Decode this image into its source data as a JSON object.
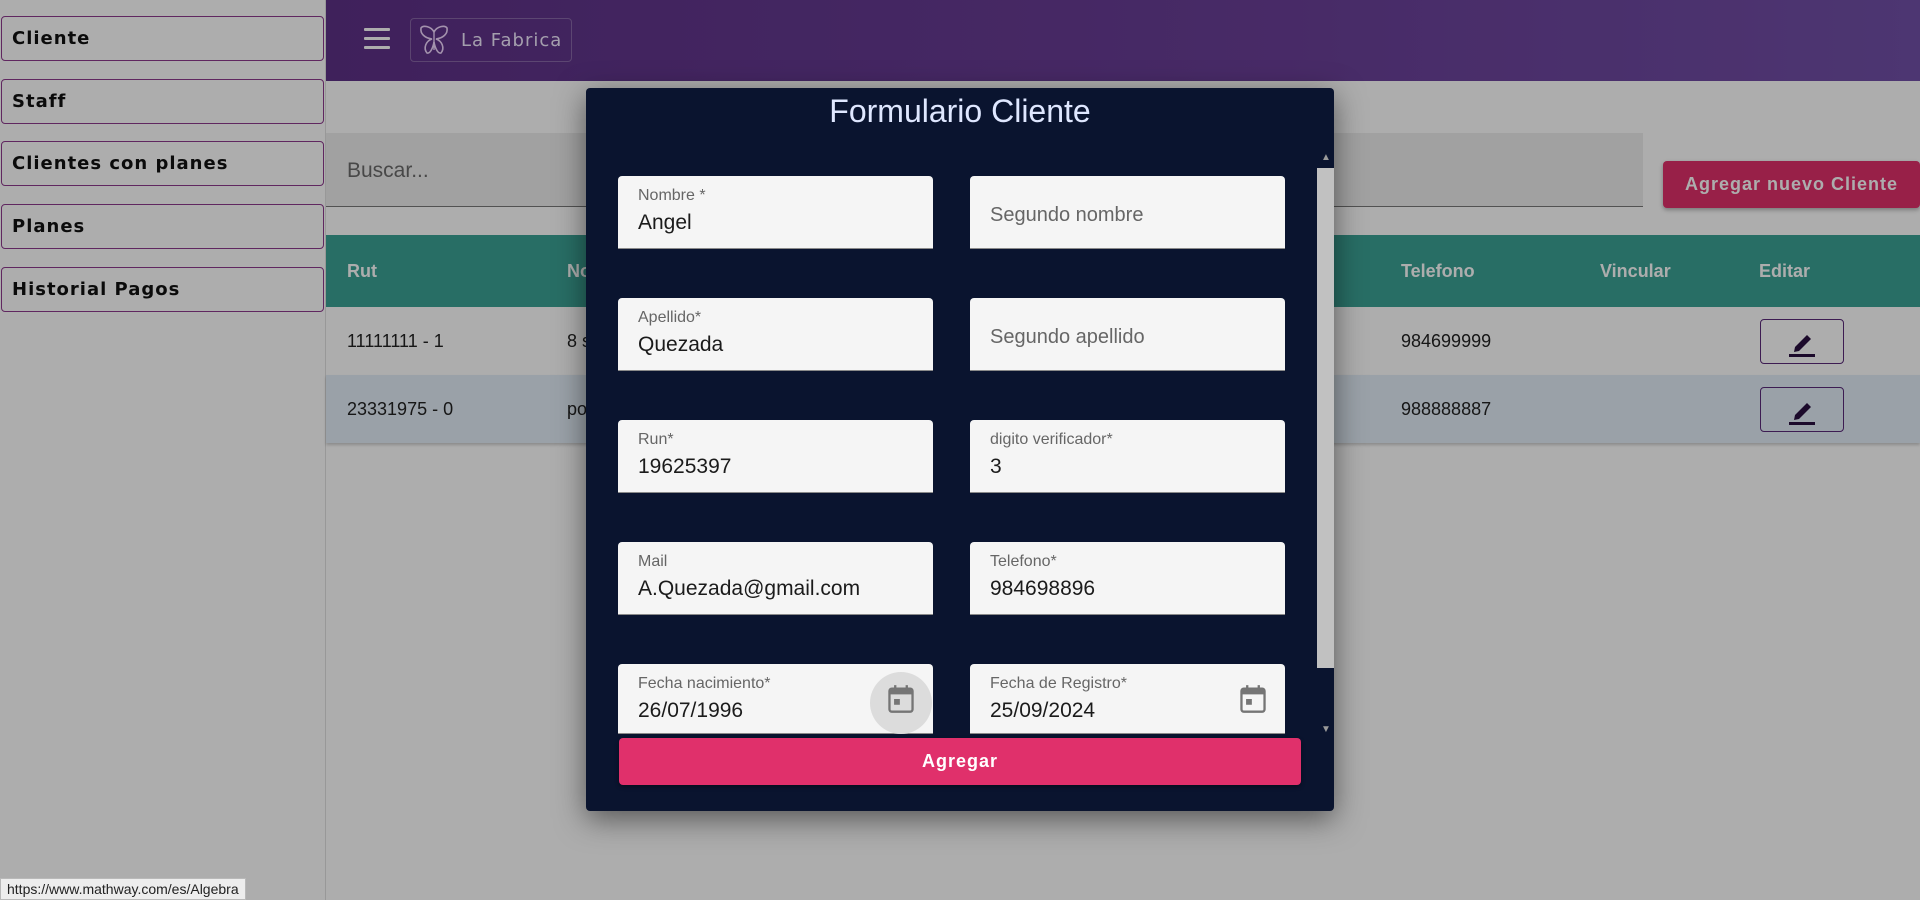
{
  "sidebar": {
    "items": [
      {
        "label": "Cliente"
      },
      {
        "label": "Staff"
      },
      {
        "label": "Clientes con planes"
      },
      {
        "label": "Planes"
      },
      {
        "label": "Historial Pagos"
      }
    ]
  },
  "appbar": {
    "brand": "La Fabrica",
    "menu_icon": "menu-icon",
    "logo_icon": "butterfly-icon",
    "gradient": [
      "#5e3187",
      "#7250a8"
    ]
  },
  "search": {
    "placeholder": "Buscar..."
  },
  "add_button": {
    "label": "Agregar nuevo Cliente",
    "color": "#e0306b"
  },
  "table": {
    "headers": [
      "Rut",
      "No",
      "Telefono",
      "Vincular",
      "Editar"
    ],
    "rows": [
      {
        "rut": "11111111 - 1",
        "nombre": "8 s",
        "telefono": "984699999"
      },
      {
        "rut": "23331975 - 0",
        "nombre": "po",
        "telefono": "988888887"
      }
    ],
    "header_color": "#3ba396"
  },
  "modal": {
    "title": "Formulario Cliente",
    "fields": {
      "nombre": {
        "label": "Nombre *",
        "value": "Angel"
      },
      "segundo_nombre": {
        "placeholder": "Segundo nombre"
      },
      "apellido": {
        "label": "Apellido*",
        "value": "Quezada"
      },
      "segundo_apellido": {
        "placeholder": "Segundo apellido"
      },
      "run": {
        "label": "Run*",
        "value": "19625397"
      },
      "digito": {
        "label": "digito verificador*",
        "value": "3"
      },
      "mail": {
        "label": "Mail",
        "value": "A.Quezada@gmail.com"
      },
      "telefono": {
        "label": "Telefono*",
        "value": "984698896"
      },
      "fecha_nacimiento": {
        "label": "Fecha nacimiento*",
        "value": "26/07/1996"
      },
      "fecha_registro": {
        "label": "Fecha de Registro*",
        "value": "25/09/2024"
      }
    },
    "submit_label": "Agregar",
    "background": "#0a142f"
  },
  "statusbar": {
    "url": "https://www.mathway.com/es/Algebra"
  }
}
